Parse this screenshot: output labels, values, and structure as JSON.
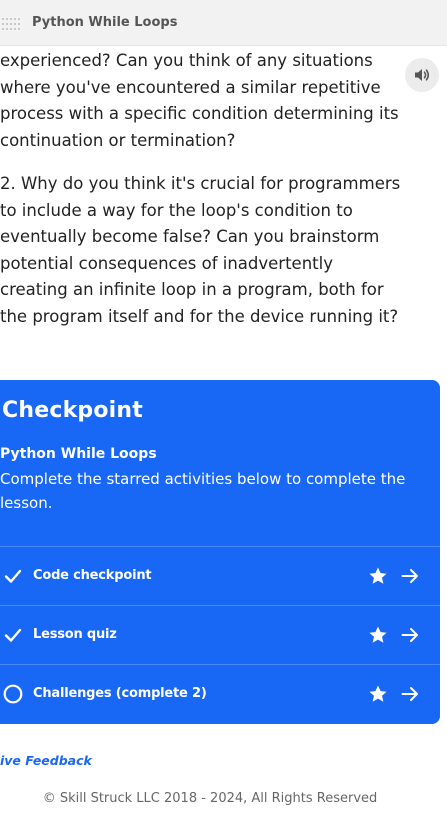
{
  "header": {
    "title": "Python While Loops"
  },
  "content": {
    "paragraph1": "experienced? Can you think of any situations where you've encountered a similar repetitive process with a specific condition determining its continuation or termination?",
    "paragraph2": "2. Why do you think it's crucial for programmers to include a way for the loop's condition to eventually become false? Can you brainstorm potential consequences of inadvertently creating an infinite loop in a program, both for the program itself and for the device running it?"
  },
  "checkpoint": {
    "title": "Checkpoint",
    "lesson_name": "Python While Loops",
    "description": "Complete the starred activities below to complete the lesson.",
    "items": [
      {
        "label": "Code checkpoint",
        "status": "complete",
        "status_icon": "check-icon",
        "starred": true
      },
      {
        "label": "Lesson quiz",
        "status": "complete",
        "status_icon": "check-icon",
        "starred": true
      },
      {
        "label": "Challenges (complete 2)",
        "status": "incomplete",
        "status_icon": "circle-icon",
        "starred": true
      }
    ]
  },
  "feedback_link": "ive Feedback",
  "footer": "© Skill Struck LLC 2018 - 2024, All Rights Reserved",
  "colors": {
    "accent": "#1967f5",
    "topbar": "#f2f2f2"
  },
  "icons": {
    "drag": "drag-handle-icon",
    "speaker": "speaker-icon",
    "star": "star-icon",
    "arrow": "arrow-right-icon"
  }
}
